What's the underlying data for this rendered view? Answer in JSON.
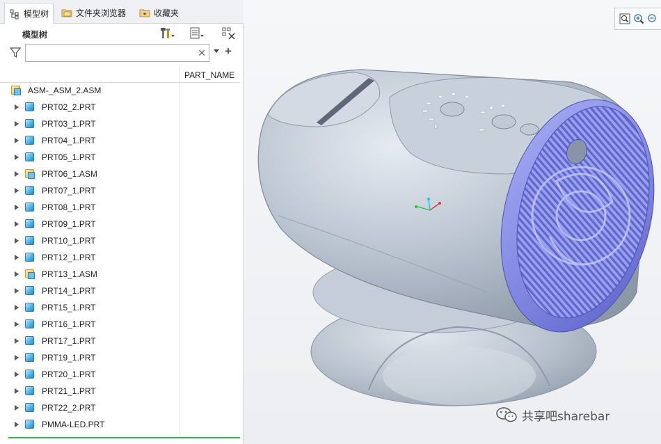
{
  "tabs": [
    {
      "label": "模型树",
      "icon": "model-tree-icon",
      "active": true
    },
    {
      "label": "文件夹浏览器",
      "icon": "folder-browser-icon",
      "active": false
    },
    {
      "label": "收藏夹",
      "icon": "favorites-icon",
      "active": false
    }
  ],
  "pane": {
    "title": "模型树",
    "search_value": "",
    "column_header": "PART_NAME"
  },
  "tree": {
    "root": "ASM-_ASM_2.ASM",
    "items": [
      {
        "label": "PRT02_2.PRT",
        "kind": "part"
      },
      {
        "label": "PRT03_1.PRT",
        "kind": "part"
      },
      {
        "label": "PRT04_1.PRT",
        "kind": "part"
      },
      {
        "label": "PRT05_1.PRT",
        "kind": "part"
      },
      {
        "label": "PRT06_1.ASM",
        "kind": "assembly"
      },
      {
        "label": "PRT07_1.PRT",
        "kind": "part"
      },
      {
        "label": "PRT08_1.PRT",
        "kind": "part"
      },
      {
        "label": "PRT09_1.PRT",
        "kind": "part"
      },
      {
        "label": "PRT10_1.PRT",
        "kind": "part"
      },
      {
        "label": "PRT12_1.PRT",
        "kind": "part"
      },
      {
        "label": "PRT13_1.ASM",
        "kind": "assembly"
      },
      {
        "label": "PRT14_1.PRT",
        "kind": "part"
      },
      {
        "label": "PRT15_1.PRT",
        "kind": "part"
      },
      {
        "label": "PRT16_1.PRT",
        "kind": "part"
      },
      {
        "label": "PRT17_1.PRT",
        "kind": "part"
      },
      {
        "label": "PRT19_1.PRT",
        "kind": "part"
      },
      {
        "label": "PRT20_1.PRT",
        "kind": "part"
      },
      {
        "label": "PRT21_1.PRT",
        "kind": "part"
      },
      {
        "label": "PRT22_2.PRT",
        "kind": "part"
      },
      {
        "label": "PMMA-LED.PRT",
        "kind": "part"
      }
    ]
  },
  "viewport": {
    "toolbar_icons": [
      "zoom-fit-icon",
      "zoom-in-icon",
      "zoom-out-icon"
    ],
    "model": "desk-fan-assembly",
    "colors": {
      "body": "#b8c2cf",
      "grille": "#7f86e0",
      "background": "#eef0f3"
    }
  },
  "watermark": "共享吧sharebar"
}
